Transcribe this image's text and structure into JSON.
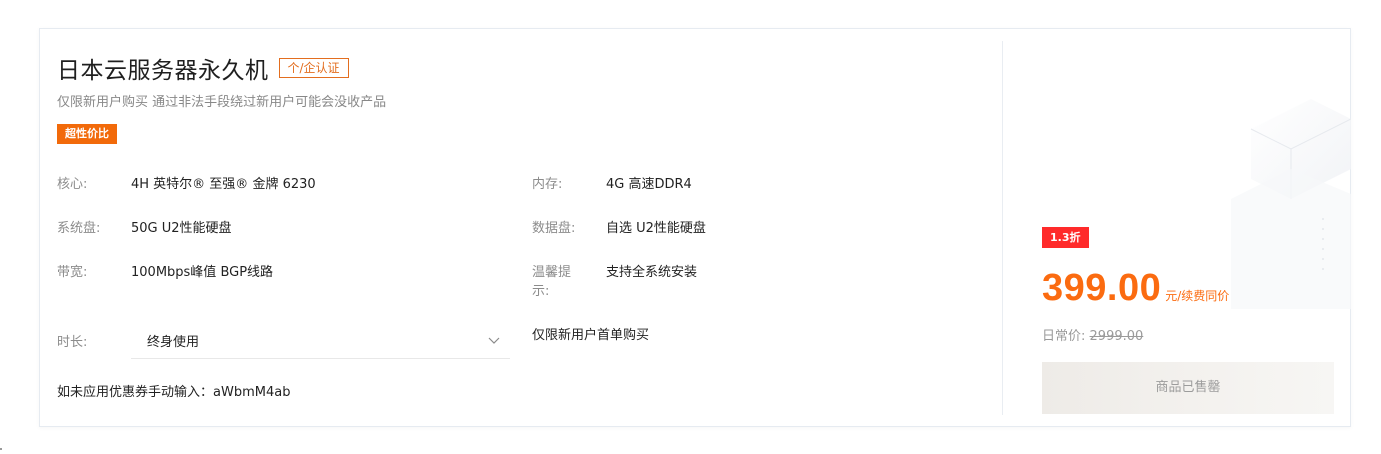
{
  "product": {
    "title": "日本云服务器永久机",
    "cert_badge": "个/企认证",
    "subtitle": "仅限新用户购买 通过非法手段绕过新用户可能会没收产品",
    "tag": "超性价比"
  },
  "specs": {
    "cpu": {
      "label": "核心:",
      "value": "4H 英特尔® 至强® 金牌 6230"
    },
    "memory": {
      "label": "内存:",
      "value": "4G 高速DDR4"
    },
    "system_disk": {
      "label": "系统盘:",
      "value": "50G U2性能硬盘"
    },
    "data_disk": {
      "label": "数据盘:",
      "value": "自选 U2性能硬盘"
    },
    "bandwidth": {
      "label": "带宽:",
      "value": "100Mbps峰值 BGP线路"
    },
    "tip": {
      "label_line1": "温馨提",
      "label_line2": "示:",
      "value": "支持全系统安装"
    }
  },
  "duration": {
    "label": "时长:",
    "selected": "终身使用"
  },
  "first_purchase_note": "仅限新用户首单购买",
  "coupon": {
    "text": "如未应用优惠券手动输入：aWbmM4ab"
  },
  "pricing": {
    "discount_badge": "1.3折",
    "price": "399.00",
    "unit": "元/续费同价",
    "original_label": "日常价:",
    "original_price": "2999.00",
    "button_label": "商品已售罄"
  },
  "icons": {
    "dropdown": "chevron-down-icon"
  },
  "colors": {
    "accent": "#fb6b10",
    "discount_bg": "#ff2a2a",
    "tag_bg": "#f26a0a",
    "badge_border": "#e36e1f"
  }
}
